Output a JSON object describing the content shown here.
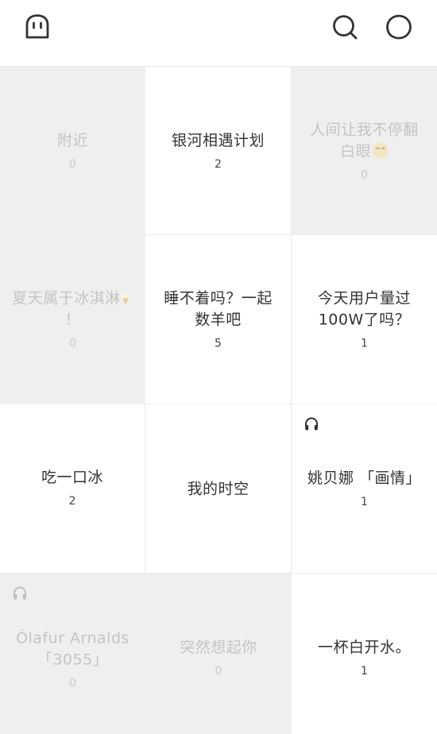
{
  "header": {
    "left_icon": "ghost-icon",
    "right_icons": [
      "search-icon",
      "chat-bubble-icon"
    ]
  },
  "tiles": [
    {
      "title": "附近",
      "count": "0",
      "style": "dim"
    },
    {
      "title": "银河相遇计划",
      "count": "2",
      "style": "light"
    },
    {
      "title": "人间让我不停翻白眼",
      "emoji": "eye-roll-face-emoji",
      "count": "0",
      "style": "dim"
    },
    {
      "title": "夏天属于冰淇淋",
      "emoji": "ice-cream-emoji",
      "title_suffix": "！",
      "count": "0",
      "style": "dim"
    },
    {
      "title": "睡不着吗？一起数羊吧",
      "count": "5",
      "style": "light"
    },
    {
      "title": "今天用户量过100W了吗？",
      "count": "1",
      "style": "light"
    },
    {
      "title": "吃一口冰",
      "count": "2",
      "style": "light"
    },
    {
      "title": "我的时空",
      "count": "",
      "style": "light"
    },
    {
      "title": "姚贝娜 「画情」",
      "count": "1",
      "style": "light",
      "icon": "headphones-icon"
    },
    {
      "title": "Ólafur Arnalds「3055」",
      "count": "0",
      "style": "dim",
      "icon": "headphones-icon"
    },
    {
      "title": "突然想起你",
      "count": "0",
      "style": "dim"
    },
    {
      "title": "一杯白开水。",
      "count": "1",
      "style": "light"
    }
  ],
  "colors": {
    "tile_light": "#ffffff",
    "tile_dim": "#efefef",
    "text_dark": "#333333",
    "text_dim": "#c4c4c4",
    "icon": "#333333"
  }
}
